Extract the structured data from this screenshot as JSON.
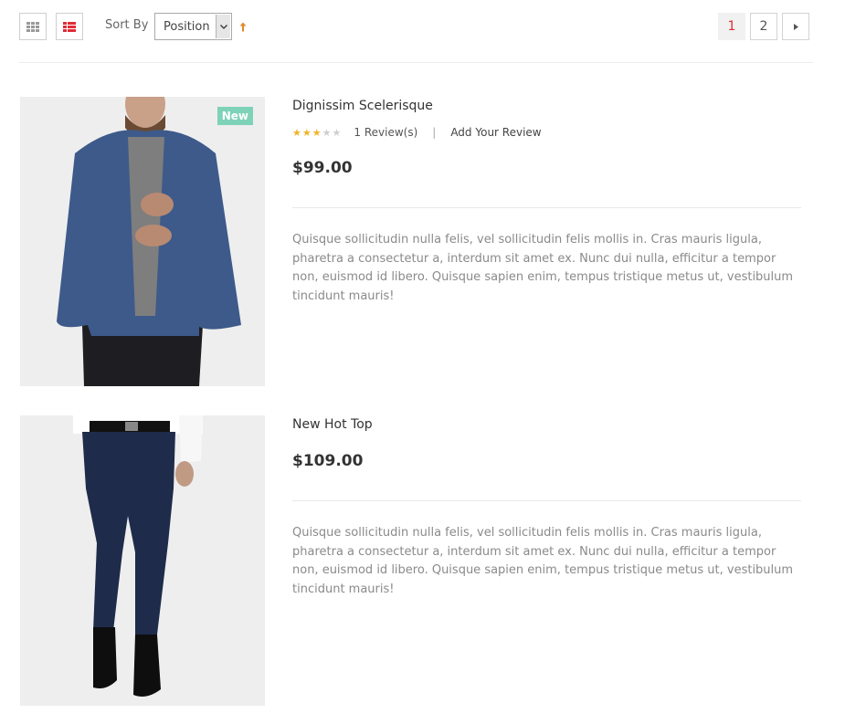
{
  "toolbar": {
    "sort_label": "Sort By",
    "sort_value": "Position",
    "views": [
      {
        "name": "grid",
        "icon": "grid-icon",
        "active": false
      },
      {
        "name": "list",
        "icon": "list-icon",
        "active": true
      }
    ],
    "sort_direction_icon": "arrow-up-icon"
  },
  "pager": {
    "pages": [
      "1",
      "2"
    ],
    "current": "1",
    "next_icon": "next-arrow-icon"
  },
  "colors": {
    "accent_red": "#e02b36",
    "badge_green": "#7ed2b7",
    "star_gold": "#f0b429",
    "sort_arrow": "#e0892b"
  },
  "products": [
    {
      "name": "Dignissim Scelerisque",
      "badge": "New",
      "rating": 3,
      "rating_max": 5,
      "reviews": "1 Review(s)",
      "add_review": "Add Your Review",
      "separator": "|",
      "price": "$99.00",
      "description": "Quisque sollicitudin nulla felis, vel sollicitudin felis mollis in. Cras mauris ligula, pharetra a consectetur a, interdum sit amet ex. Nunc dui nulla, efficitur a tempor non, euismod id libero. Quisque sapien enim, tempus tristique metus ut, vestibulum tincidunt mauris!"
    },
    {
      "name": "New Hot Top",
      "price": "$109.00",
      "description": "Quisque sollicitudin nulla felis, vel sollicitudin felis mollis in. Cras mauris ligula, pharetra a consectetur a, interdum sit amet ex. Nunc dui nulla, efficitur a tempor non, euismod id libero. Quisque sapien enim, tempus tristique metus ut, vestibulum tincidunt mauris!"
    }
  ]
}
